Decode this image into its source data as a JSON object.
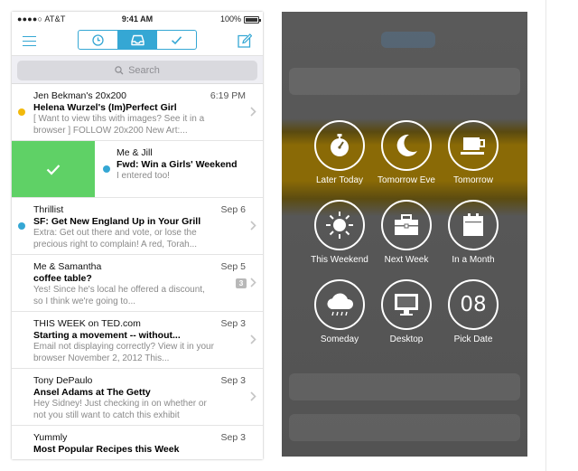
{
  "status_bar": {
    "carrier": "●●●●○ AT&T",
    "time": "9:41 AM",
    "battery": "100%"
  },
  "nav": {
    "tabs": [
      {
        "name": "later",
        "icon": "clock-icon",
        "active": false
      },
      {
        "name": "inbox",
        "icon": "inbox-tray-icon",
        "active": true
      },
      {
        "name": "done",
        "icon": "checkmark-icon",
        "active": false
      }
    ],
    "accent_color": "#35a7d4"
  },
  "search": {
    "placeholder": "Search"
  },
  "mail": [
    {
      "sender": "Jen Bekman's 20x200",
      "date": "6:19 PM",
      "subject": "Helena Wurzel's (Im)Perfect Girl",
      "preview": "[ Want to view tihs with images? See it in a browser ] FOLLOW 20x200 New Art:...",
      "dot": "#f2b90c"
    },
    {
      "sender": "Me & Jill",
      "date": "",
      "subject": "Fwd: Win a Girls' Weekend",
      "preview": "I entered too!",
      "dot": "#35a7d4",
      "swipe_color": "#5fd166"
    },
    {
      "sender": "Thrillist",
      "date": "Sep 6",
      "subject": "SF: Get New England Up in Your Grill",
      "preview": "Extra: Get out there and vote, or lose the precious right to complain! A red, Torah...",
      "dot": "#35a7d4"
    },
    {
      "sender": "Me & Samantha",
      "date": "Sep 5",
      "subject": "coffee table?",
      "preview": "Yes! Since he's local he offered a discount, so I think we're going to...",
      "dot": "",
      "count": "3"
    },
    {
      "sender": "THIS WEEK on TED.com",
      "date": "Sep 3",
      "subject": "Starting a movement -- without...",
      "preview": "Email not displaying correctly? View it in your browser November 2, 2012 This...",
      "dot": ""
    },
    {
      "sender": "Tony DePaulo",
      "date": "Sep 3",
      "subject": "Ansel Adams at The Getty",
      "preview": "Hey Sidney! Just checking in on whether or not you still want to catch this exhibit",
      "dot": ""
    },
    {
      "sender": "Yummly",
      "date": "Sep 3",
      "subject": "Most Popular Recipes this Week",
      "preview": "",
      "dot": ""
    }
  ],
  "snooze": {
    "highlight_color": "#8a6a06",
    "options": [
      {
        "label": "Later Today",
        "icon": "stopwatch-icon"
      },
      {
        "label": "Tomorrow Eve",
        "icon": "moon-icon"
      },
      {
        "label": "Tomorrow",
        "icon": "coffee-cup-icon"
      },
      {
        "label": "This Weekend",
        "icon": "sun-icon"
      },
      {
        "label": "Next Week",
        "icon": "briefcase-icon"
      },
      {
        "label": "In a Month",
        "icon": "calendar-icon"
      },
      {
        "label": "Someday",
        "icon": "rain-cloud-icon"
      },
      {
        "label": "Desktop",
        "icon": "monitor-icon"
      },
      {
        "label": "Pick Date",
        "icon": "pick-date-icon",
        "value": "08"
      }
    ]
  }
}
